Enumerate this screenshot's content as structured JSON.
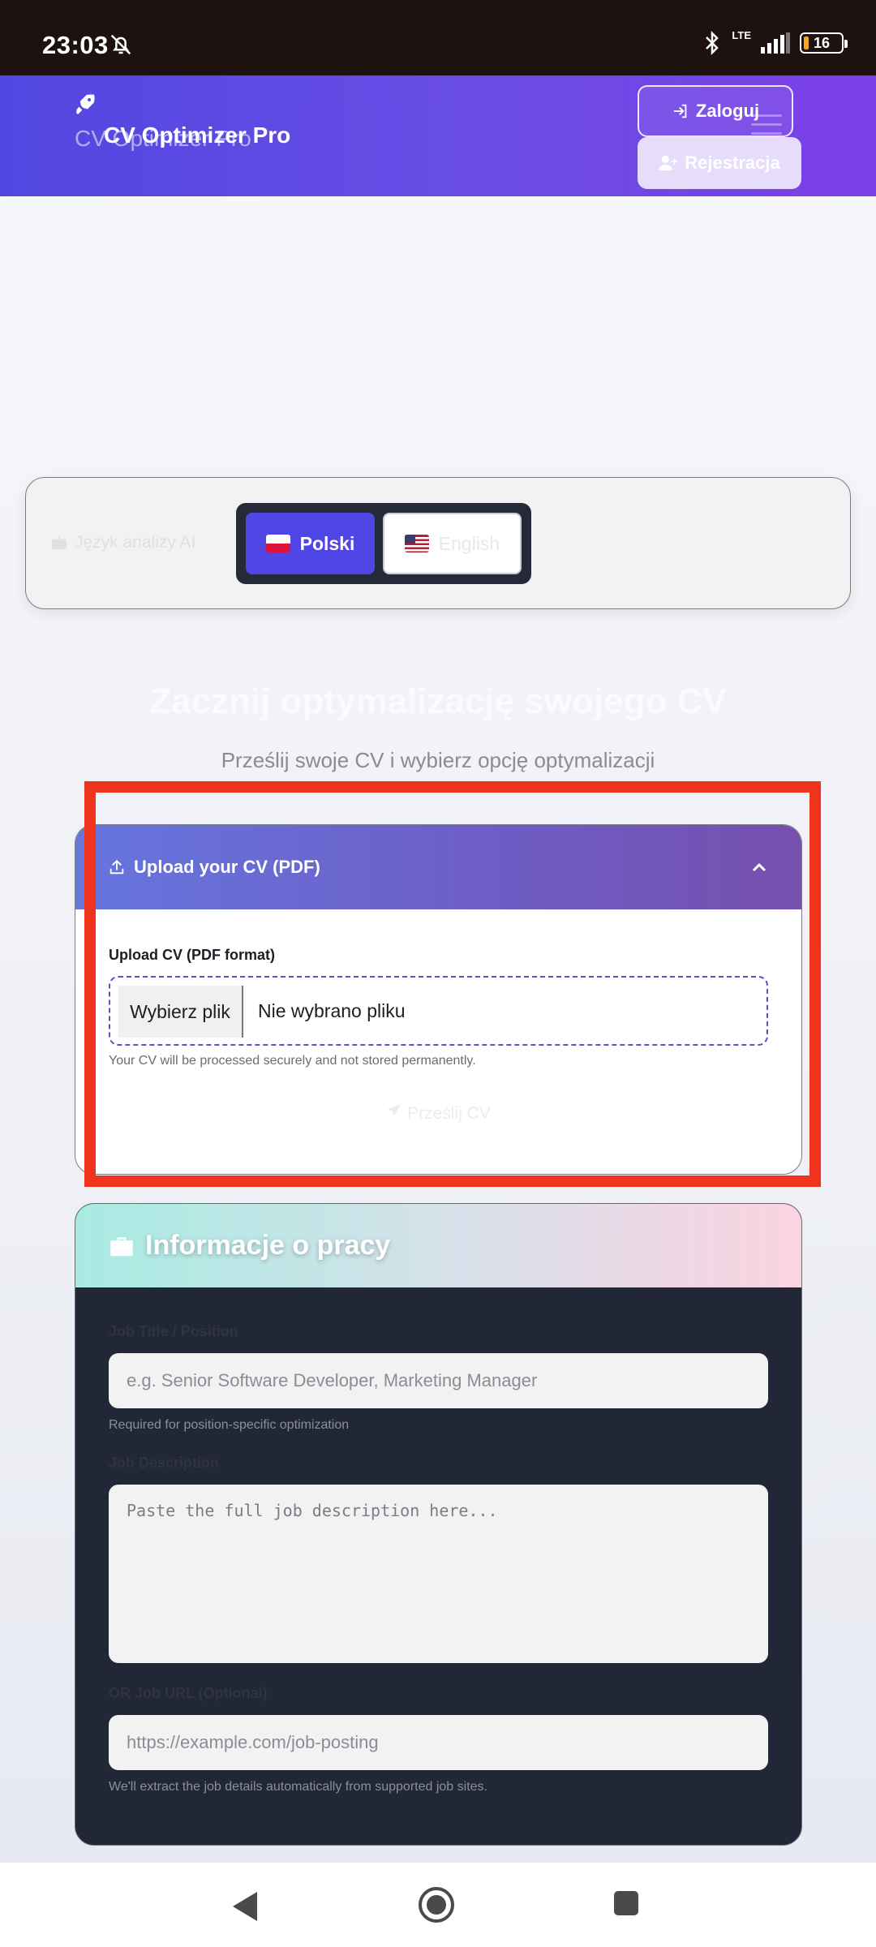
{
  "status_bar": {
    "time": "23:03",
    "network": "LTE",
    "battery": "16"
  },
  "header": {
    "brand": "CV Optimizer Pro",
    "login_label": "Zaloguj",
    "register_label": "Rejestracja"
  },
  "language": {
    "label": "Język analizy AI",
    "polish": "Polski",
    "english": "English",
    "selected": "Polski"
  },
  "hero": {
    "title": "Zacznij optymalizację swojego CV",
    "subtitle": "Prześlij swoje CV i wybierz opcję optymalizacji"
  },
  "upload": {
    "title": "Upload your CV (PDF)",
    "field_label": "Upload CV (PDF format)",
    "choose_file": "Wybierz plik",
    "no_file": "Nie wybrano pliku",
    "hint": "Your CV will be processed securely and not stored permanently.",
    "submit": "Prześlij CV"
  },
  "job": {
    "title": "Informacje o pracy",
    "position_label": "Job Title / Position",
    "position_placeholder": "e.g. Senior Software Developer, Marketing Manager",
    "position_hint": "Required for position-specific optimization",
    "description_label": "Job Description",
    "description_placeholder": "Paste the full job description here...",
    "url_label": "OR Job URL (Optional)",
    "url_placeholder": "https://example.com/job-posting",
    "url_hint": "We'll extract the job details automatically from supported job sites."
  }
}
